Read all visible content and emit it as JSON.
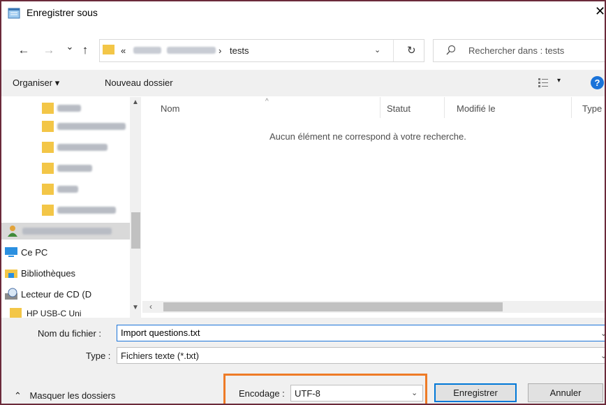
{
  "window": {
    "title": "Enregistrer sous",
    "close_glyph": "✕"
  },
  "address": {
    "back_glyph": "←",
    "forward_glyph": "→",
    "recent_glyph": "⌄",
    "up_glyph": "↑",
    "overflow": "«",
    "separator": "›",
    "current_folder": "tests",
    "dropdown_glyph": "⌄",
    "refresh_glyph": "↻"
  },
  "search": {
    "icon": "search-icon",
    "placeholder": "Rechercher dans : tests"
  },
  "toolbar": {
    "organize_label": "Organiser ▾",
    "new_folder_label": "Nouveau dossier",
    "view_dropdown": "▾",
    "help_label": "?"
  },
  "nav": {
    "items": [
      {
        "label": "Ce PC",
        "icon": "pc-icon"
      },
      {
        "label": "Bibliothèques",
        "icon": "library-icon"
      },
      {
        "label": "Lecteur de CD (D",
        "icon": "cd-drive-icon"
      },
      {
        "label": "HP USB-C Uni",
        "icon": "drive-icon"
      }
    ]
  },
  "columns": [
    {
      "label": "Nom"
    },
    {
      "label": "Statut"
    },
    {
      "label": "Modifié le"
    },
    {
      "label": "Type"
    }
  ],
  "list": {
    "empty_message": "Aucun élément ne correspond à votre recherche."
  },
  "form": {
    "filename_label": "Nom du fichier :",
    "filename_value": "Import questions.txt",
    "type_label": "Type :",
    "type_value": "Fichiers texte (*.txt)",
    "hide_folders_label": "Masquer les dossiers",
    "encoding_label": "Encodage :",
    "encoding_value": "UTF-8",
    "save_label": "Enregistrer",
    "cancel_label": "Annuler"
  },
  "colors": {
    "highlight": "#ee7b27",
    "accent": "#0078d7"
  }
}
